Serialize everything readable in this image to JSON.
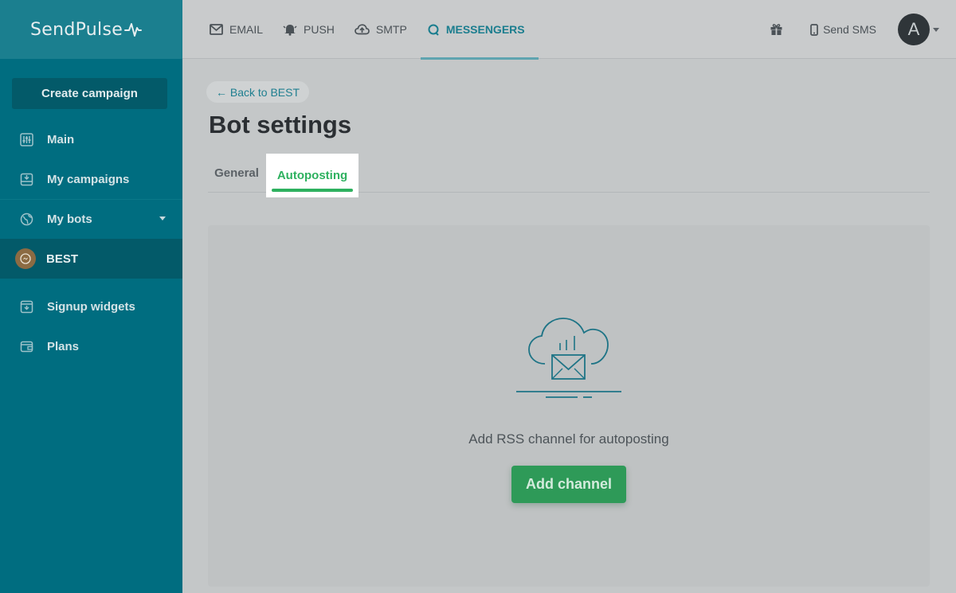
{
  "app": {
    "brand": "SendPulse"
  },
  "colors": {
    "sidebar": "#006d80",
    "accent": "#1a7d8e",
    "success": "#2eb15f",
    "button": "#2e9a58"
  },
  "sidebar": {
    "create_label": "Create campaign",
    "items": [
      {
        "label": "Main",
        "icon": "sliders-icon"
      },
      {
        "label": "My campaigns",
        "icon": "campaigns-icon"
      },
      {
        "label": "My bots",
        "icon": "globe-icon"
      },
      {
        "label": "BEST",
        "icon": "messenger-avatar"
      },
      {
        "label": "Signup widgets",
        "icon": "widget-icon"
      },
      {
        "label": "Plans",
        "icon": "wallet-icon"
      }
    ]
  },
  "topbar": {
    "tabs": [
      {
        "label": "EMAIL",
        "icon": "mail-icon"
      },
      {
        "label": "PUSH",
        "icon": "bell-icon"
      },
      {
        "label": "SMTP",
        "icon": "cloud-upload-icon"
      },
      {
        "label": "MESSENGERS",
        "icon": "chat-icon"
      }
    ],
    "sms_label": "Send SMS",
    "avatar_letter": "A"
  },
  "content": {
    "back_label": "← Back to BEST",
    "title": "Bot settings",
    "tabs": [
      {
        "label": "General"
      },
      {
        "label": "Autoposting"
      }
    ],
    "empty_text": "Add RSS channel for autoposting",
    "add_label": "Add channel"
  }
}
